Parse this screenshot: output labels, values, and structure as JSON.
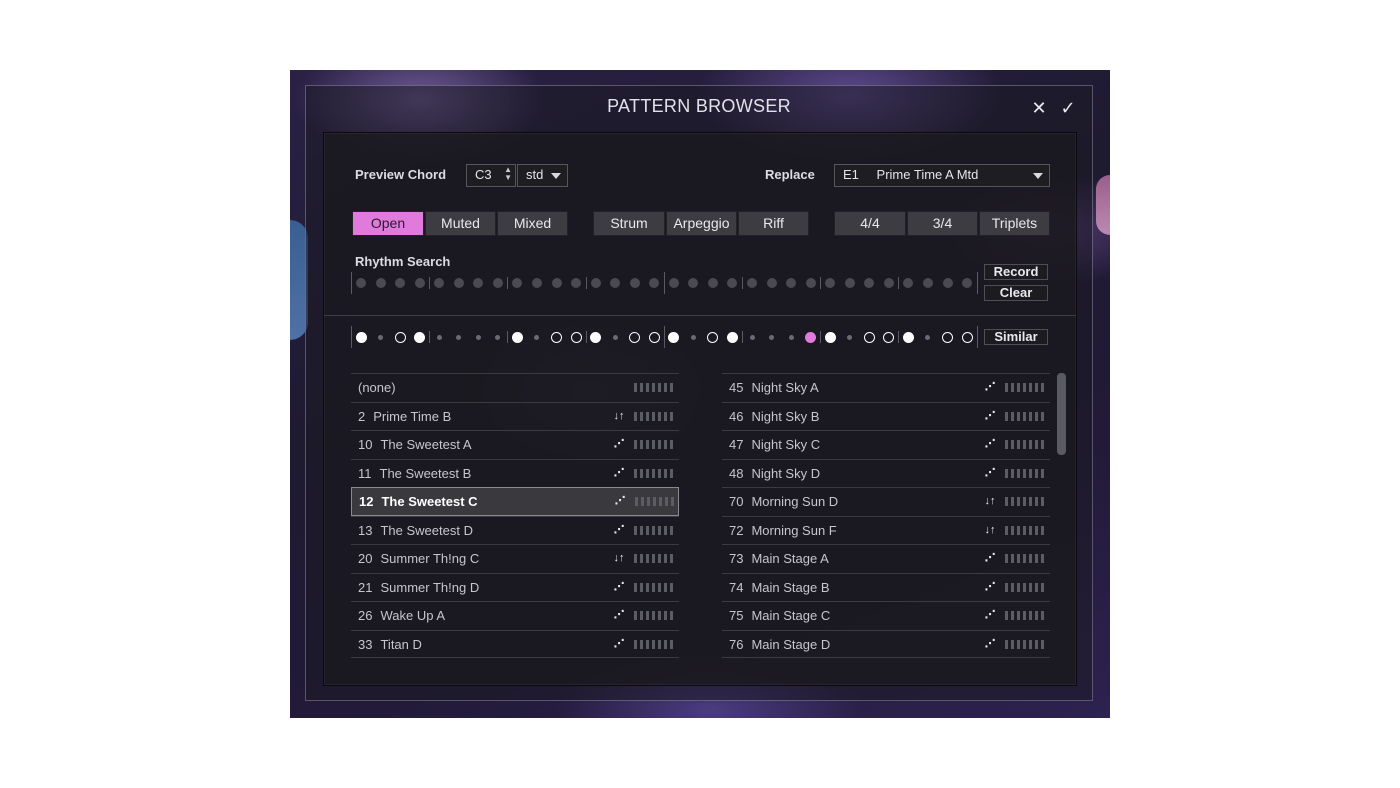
{
  "dialog": {
    "title": "PATTERN BROWSER",
    "close_glyph": "✕",
    "confirm_glyph": "✓"
  },
  "preview": {
    "label": "Preview Chord",
    "chord": "C3",
    "chord_type": "std"
  },
  "replace": {
    "label": "Replace",
    "slot": "E1",
    "value": "Prime Time A Mtd"
  },
  "filters": {
    "technique": [
      {
        "label": "Open",
        "active": true
      },
      {
        "label": "Muted",
        "active": false
      },
      {
        "label": "Mixed",
        "active": false
      }
    ],
    "style": [
      {
        "label": "Strum",
        "active": false
      },
      {
        "label": "Arpeggio",
        "active": false
      },
      {
        "label": "Riff",
        "active": false
      }
    ],
    "meter": [
      {
        "label": "4/4",
        "active": false
      },
      {
        "label": "3/4",
        "active": false
      },
      {
        "label": "Triplets",
        "active": false
      }
    ]
  },
  "rhythm_search": {
    "label": "Rhythm Search",
    "record_label": "Record",
    "clear_label": "Clear",
    "steps": 32
  },
  "pattern_preview": {
    "similar_label": "Similar",
    "steps": [
      "F",
      "s",
      "O",
      "F",
      "s",
      "s",
      "s",
      "s",
      "F",
      "s",
      "O",
      "O",
      "F",
      "s",
      "O",
      "O",
      "F",
      "s",
      "O",
      "F",
      "s",
      "s",
      "s",
      "P",
      "F",
      "s",
      "O",
      "O",
      "F",
      "s",
      "O",
      "O"
    ]
  },
  "list_left": [
    {
      "num": "",
      "name": "(none)",
      "icon": ""
    },
    {
      "num": "2",
      "name": "Prime Time B",
      "icon": "updown"
    },
    {
      "num": "10",
      "name": "The Sweetest A",
      "icon": "strum"
    },
    {
      "num": "11",
      "name": "The Sweetest B",
      "icon": "strum"
    },
    {
      "num": "12",
      "name": "The Sweetest C",
      "icon": "strum",
      "selected": true
    },
    {
      "num": "13",
      "name": "The Sweetest D",
      "icon": "strum"
    },
    {
      "num": "20",
      "name": "Summer Th!ng C",
      "icon": "updown"
    },
    {
      "num": "21",
      "name": "Summer Th!ng D",
      "icon": "strum"
    },
    {
      "num": "26",
      "name": "Wake Up A",
      "icon": "strum"
    },
    {
      "num": "33",
      "name": "Titan D",
      "icon": "strum"
    }
  ],
  "list_right": [
    {
      "num": "45",
      "name": "Night Sky A",
      "icon": "strum"
    },
    {
      "num": "46",
      "name": "Night Sky B",
      "icon": "strum"
    },
    {
      "num": "47",
      "name": "Night Sky C",
      "icon": "strum"
    },
    {
      "num": "48",
      "name": "Night Sky D",
      "icon": "strum"
    },
    {
      "num": "70",
      "name": "Morning Sun D",
      "icon": "updown"
    },
    {
      "num": "72",
      "name": "Morning Sun F",
      "icon": "updown"
    },
    {
      "num": "73",
      "name": "Main Stage A",
      "icon": "strum"
    },
    {
      "num": "74",
      "name": "Main Stage B",
      "icon": "strum"
    },
    {
      "num": "75",
      "name": "Main Stage C",
      "icon": "strum"
    },
    {
      "num": "76",
      "name": "Main Stage D",
      "icon": "strum"
    }
  ],
  "colors": {
    "accent": "#e07adc",
    "panel": "#19181e"
  },
  "icons": {
    "updown": "↓↑",
    "strum": "⋰"
  }
}
